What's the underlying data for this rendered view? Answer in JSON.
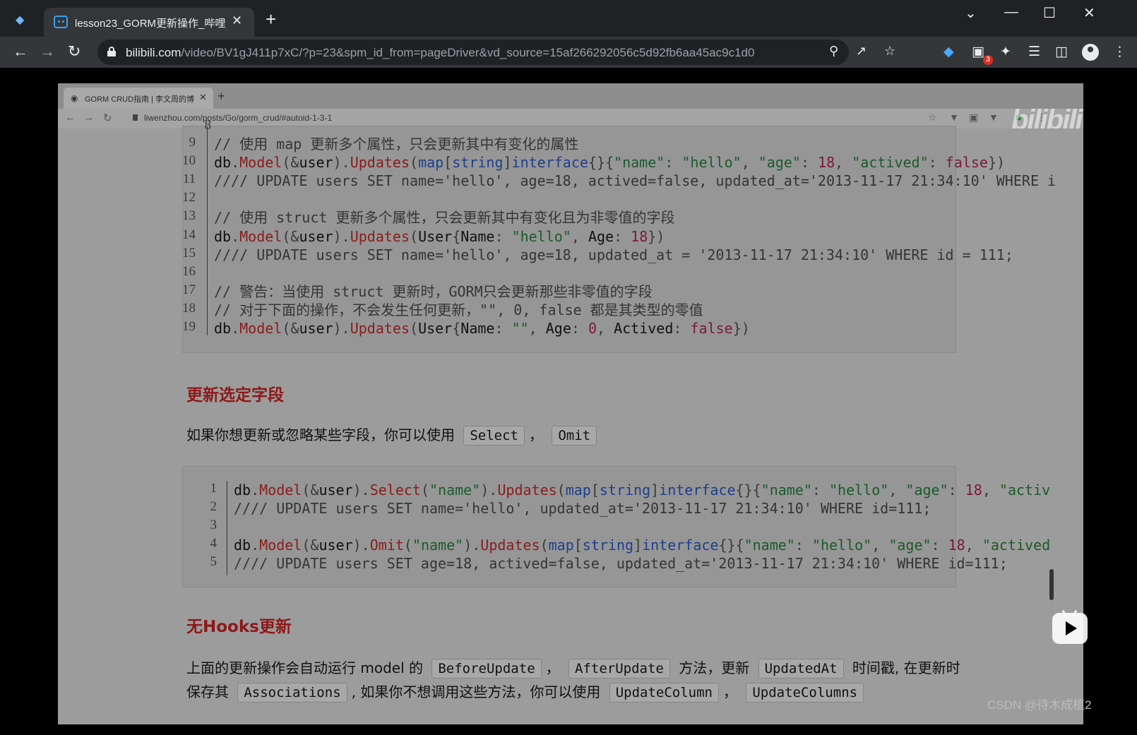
{
  "outer_browser": {
    "tab_title": "lesson23_GORM更新操作_哔哩",
    "url_host": "bilibili.com",
    "url_path": "/video/BV1gJ411p7xC/?p=23&spm_id_from=pageDriver&vd_source=15af266292056c5d92fb6aa45ac9c1d0",
    "extension_badge": "3"
  },
  "inner_browser": {
    "tab_title": "GORM CRUD指南 | 李文周的博",
    "url": "liwenzhou.com/posts/Go/gorm_crud/#autoid-1-3-1"
  },
  "watermark": "bilibili",
  "code_block_1": {
    "partial_line_number": "8",
    "lines": [
      {
        "n": "9",
        "segments": [
          [
            "c-cmt",
            "// 使用 map 更新多个属性，只会更新其中有变化的属性"
          ]
        ]
      },
      {
        "n": "10",
        "segments": [
          [
            "c-id",
            "db"
          ],
          [
            "c-pun",
            "."
          ],
          [
            "c-fn",
            "Model"
          ],
          [
            "c-pun",
            "(&"
          ],
          [
            "c-id",
            "user"
          ],
          [
            "c-pun",
            ")."
          ],
          [
            "c-fn",
            "Updates"
          ],
          [
            "c-pun",
            "("
          ],
          [
            "c-kw",
            "map"
          ],
          [
            "c-pun",
            "["
          ],
          [
            "c-kw",
            "string"
          ],
          [
            "c-pun",
            "]"
          ],
          [
            "c-kw",
            "interface"
          ],
          [
            "c-pun",
            "{}{"
          ],
          [
            "c-str",
            "\"name\""
          ],
          [
            "c-pun",
            ": "
          ],
          [
            "c-str",
            "\"hello\""
          ],
          [
            "c-pun",
            ", "
          ],
          [
            "c-str",
            "\"age\""
          ],
          [
            "c-pun",
            ": "
          ],
          [
            "c-num",
            "18"
          ],
          [
            "c-pun",
            ", "
          ],
          [
            "c-str",
            "\"actived\""
          ],
          [
            "c-pun",
            ": "
          ],
          [
            "c-num",
            "false"
          ],
          [
            "c-pun",
            "})"
          ]
        ]
      },
      {
        "n": "11",
        "segments": [
          [
            "c-cmt",
            "//// UPDATE users SET name='hello', age=18, actived=false, updated_at='2013-11-17 21:34:10' WHERE i"
          ]
        ]
      },
      {
        "n": "12",
        "segments": []
      },
      {
        "n": "13",
        "segments": [
          [
            "c-cmt",
            "// 使用 struct 更新多个属性，只会更新其中有变化且为非零值的字段"
          ]
        ]
      },
      {
        "n": "14",
        "segments": [
          [
            "c-id",
            "db"
          ],
          [
            "c-pun",
            "."
          ],
          [
            "c-fn",
            "Model"
          ],
          [
            "c-pun",
            "(&"
          ],
          [
            "c-id",
            "user"
          ],
          [
            "c-pun",
            ")."
          ],
          [
            "c-fn",
            "Updates"
          ],
          [
            "c-pun",
            "("
          ],
          [
            "c-id",
            "User"
          ],
          [
            "c-pun",
            "{"
          ],
          [
            "c-id",
            "Name"
          ],
          [
            "c-pun",
            ": "
          ],
          [
            "c-str",
            "\"hello\""
          ],
          [
            "c-pun",
            ", "
          ],
          [
            "c-id",
            "Age"
          ],
          [
            "c-pun",
            ": "
          ],
          [
            "c-num",
            "18"
          ],
          [
            "c-pun",
            "})"
          ]
        ]
      },
      {
        "n": "15",
        "segments": [
          [
            "c-cmt",
            "//// UPDATE users SET name='hello', age=18, updated_at = '2013-11-17 21:34:10' WHERE id = 111;"
          ]
        ]
      },
      {
        "n": "16",
        "segments": []
      },
      {
        "n": "17",
        "segments": [
          [
            "c-cmt",
            "// 警告：当使用 struct 更新时，GORM只会更新那些非零值的字段"
          ]
        ]
      },
      {
        "n": "18",
        "segments": [
          [
            "c-cmt",
            "// 对于下面的操作，不会发生任何更新，\"\", 0, false 都是其类型的零值"
          ]
        ]
      },
      {
        "n": "19",
        "segments": [
          [
            "c-id",
            "db"
          ],
          [
            "c-pun",
            "."
          ],
          [
            "c-fn",
            "Model"
          ],
          [
            "c-pun",
            "(&"
          ],
          [
            "c-id",
            "user"
          ],
          [
            "c-pun",
            ")."
          ],
          [
            "c-fn",
            "Updates"
          ],
          [
            "c-pun",
            "("
          ],
          [
            "c-id",
            "User"
          ],
          [
            "c-pun",
            "{"
          ],
          [
            "c-id",
            "Name"
          ],
          [
            "c-pun",
            ": "
          ],
          [
            "c-str",
            "\"\""
          ],
          [
            "c-pun",
            ", "
          ],
          [
            "c-id",
            "Age"
          ],
          [
            "c-pun",
            ": "
          ],
          [
            "c-num",
            "0"
          ],
          [
            "c-pun",
            ", "
          ],
          [
            "c-id",
            "Actived"
          ],
          [
            "c-pun",
            ": "
          ],
          [
            "c-num",
            "false"
          ],
          [
            "c-pun",
            "})"
          ]
        ]
      }
    ]
  },
  "section_select": {
    "heading": "更新选定字段",
    "para_prefix": "如果你想更新或忽略某些字段，你可以使用",
    "code1": "Select",
    "sep": "，",
    "code2": "Omit"
  },
  "code_block_2": {
    "lines": [
      {
        "n": "1",
        "segments": [
          [
            "c-id",
            "db"
          ],
          [
            "c-pun",
            "."
          ],
          [
            "c-fn",
            "Model"
          ],
          [
            "c-pun",
            "(&"
          ],
          [
            "c-id",
            "user"
          ],
          [
            "c-pun",
            ")."
          ],
          [
            "c-fn",
            "Select"
          ],
          [
            "c-pun",
            "("
          ],
          [
            "c-str",
            "\"name\""
          ],
          [
            "c-pun",
            ")."
          ],
          [
            "c-fn",
            "Updates"
          ],
          [
            "c-pun",
            "("
          ],
          [
            "c-kw",
            "map"
          ],
          [
            "c-pun",
            "["
          ],
          [
            "c-kw",
            "string"
          ],
          [
            "c-pun",
            "]"
          ],
          [
            "c-kw",
            "interface"
          ],
          [
            "c-pun",
            "{}{"
          ],
          [
            "c-str",
            "\"name\""
          ],
          [
            "c-pun",
            ": "
          ],
          [
            "c-str",
            "\"hello\""
          ],
          [
            "c-pun",
            ", "
          ],
          [
            "c-str",
            "\"age\""
          ],
          [
            "c-pun",
            ": "
          ],
          [
            "c-num",
            "18"
          ],
          [
            "c-pun",
            ", "
          ],
          [
            "c-str",
            "\"activ"
          ]
        ]
      },
      {
        "n": "2",
        "segments": [
          [
            "c-cmt",
            "//// UPDATE users SET name='hello', updated_at='2013-11-17 21:34:10' WHERE id=111;"
          ]
        ]
      },
      {
        "n": "3",
        "segments": []
      },
      {
        "n": "4",
        "segments": [
          [
            "c-id",
            "db"
          ],
          [
            "c-pun",
            "."
          ],
          [
            "c-fn",
            "Model"
          ],
          [
            "c-pun",
            "(&"
          ],
          [
            "c-id",
            "user"
          ],
          [
            "c-pun",
            ")."
          ],
          [
            "c-fn",
            "Omit"
          ],
          [
            "c-pun",
            "("
          ],
          [
            "c-str",
            "\"name\""
          ],
          [
            "c-pun",
            ")."
          ],
          [
            "c-fn",
            "Updates"
          ],
          [
            "c-pun",
            "("
          ],
          [
            "c-kw",
            "map"
          ],
          [
            "c-pun",
            "["
          ],
          [
            "c-kw",
            "string"
          ],
          [
            "c-pun",
            "]"
          ],
          [
            "c-kw",
            "interface"
          ],
          [
            "c-pun",
            "{}{"
          ],
          [
            "c-str",
            "\"name\""
          ],
          [
            "c-pun",
            ": "
          ],
          [
            "c-str",
            "\"hello\""
          ],
          [
            "c-pun",
            ", "
          ],
          [
            "c-str",
            "\"age\""
          ],
          [
            "c-pun",
            ": "
          ],
          [
            "c-num",
            "18"
          ],
          [
            "c-pun",
            ", "
          ],
          [
            "c-str",
            "\"actived"
          ]
        ]
      },
      {
        "n": "5",
        "segments": [
          [
            "c-cmt",
            "//// UPDATE users SET age=18, actived=false, updated_at='2013-11-17 21:34:10' WHERE id=111;"
          ]
        ]
      }
    ]
  },
  "section_hooks": {
    "heading": "无Hooks更新",
    "line1_a": "上面的更新操作会自动运行 model 的",
    "code_a": "BeforeUpdate",
    "sep_a": "，",
    "code_b": "AfterUpdate",
    "line1_b": "方法，更新",
    "code_c": "UpdatedAt",
    "line1_c": "时间戳, 在更新时",
    "line2_a": "保存其",
    "code_d": "Associations",
    "line2_b": ", 如果你不想调用这些方法，你可以使用",
    "code_e": "UpdateColumn",
    "sep_b": "，",
    "code_f": "UpdateColumns"
  },
  "csdn_watermark": "CSDN @待木成植2"
}
